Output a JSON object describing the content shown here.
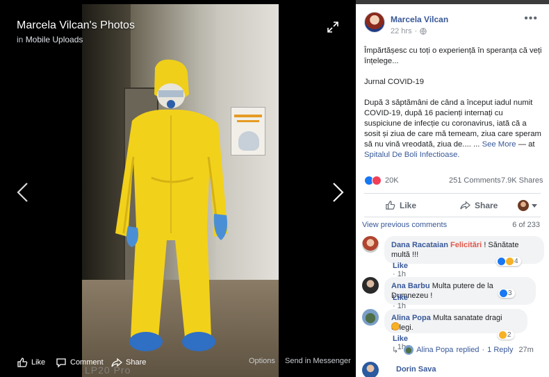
{
  "viewer": {
    "title": "Marcela Vilcan's Photos",
    "subtitle_prefix": "in",
    "album": "Mobile Uploads",
    "watermark": "LP20 Pro",
    "actions": {
      "like": "Like",
      "comment": "Comment",
      "share": "Share",
      "options": "Options",
      "messenger": "Send in Messenger"
    }
  },
  "post": {
    "author": "Marcela Vilcan",
    "time": "22 hrs",
    "privacy_icon": "globe-icon",
    "menu": "•••",
    "paragraphs": [
      "Împărtășesc cu toți o experiență în speranța că veți înțelege...",
      "Jurnal COVID-19"
    ],
    "body_main": "După 3 săptămâni de când a început iadul numit COVID-19, după 16 pacienți internați cu suspiciune de infecție cu coronavirus, iată că a sosit și ziua de care mă temeam, ziua care speram să nu vină vreodată, ziua de.... ...",
    "see_more": "See More",
    "at_text": "— at",
    "location": "Spitalul De Boli Infectioase.",
    "reactions_count": "20K",
    "comments_count": "251 Comments",
    "shares_count": "7.9K Shares",
    "actions": {
      "like": "Like",
      "share": "Share"
    }
  },
  "comments": {
    "view_previous": "View previous comments",
    "page": "6 of 233",
    "items": [
      {
        "name": "Dana Racataian",
        "highlight": "Felicitări",
        "text": "! Sănătate multă !!!",
        "like": "Like",
        "time": "1h",
        "reaction_count": "4"
      },
      {
        "name": "Ana Barbu",
        "text": "Multa putere de la Dumnezeu !",
        "like": "Like",
        "time": "1h",
        "reaction_count": "3"
      },
      {
        "name": "Alina Popa",
        "text": "Multa sanatate dragi colegi.",
        "like": "Like",
        "time": "1h",
        "reaction_count": "2"
      }
    ],
    "reply_summary": {
      "name": "Alina Popa",
      "text": "replied",
      "sep": "·",
      "replies": "1 Reply",
      "time": "27m"
    },
    "last_name": "Dorin Sava"
  },
  "colors": {
    "link": "#385898",
    "like_blue": "#1877f2",
    "love_red": "#f33e58",
    "highlight_red": "#e0574a",
    "ppe_yellow": "#f2d11b"
  }
}
